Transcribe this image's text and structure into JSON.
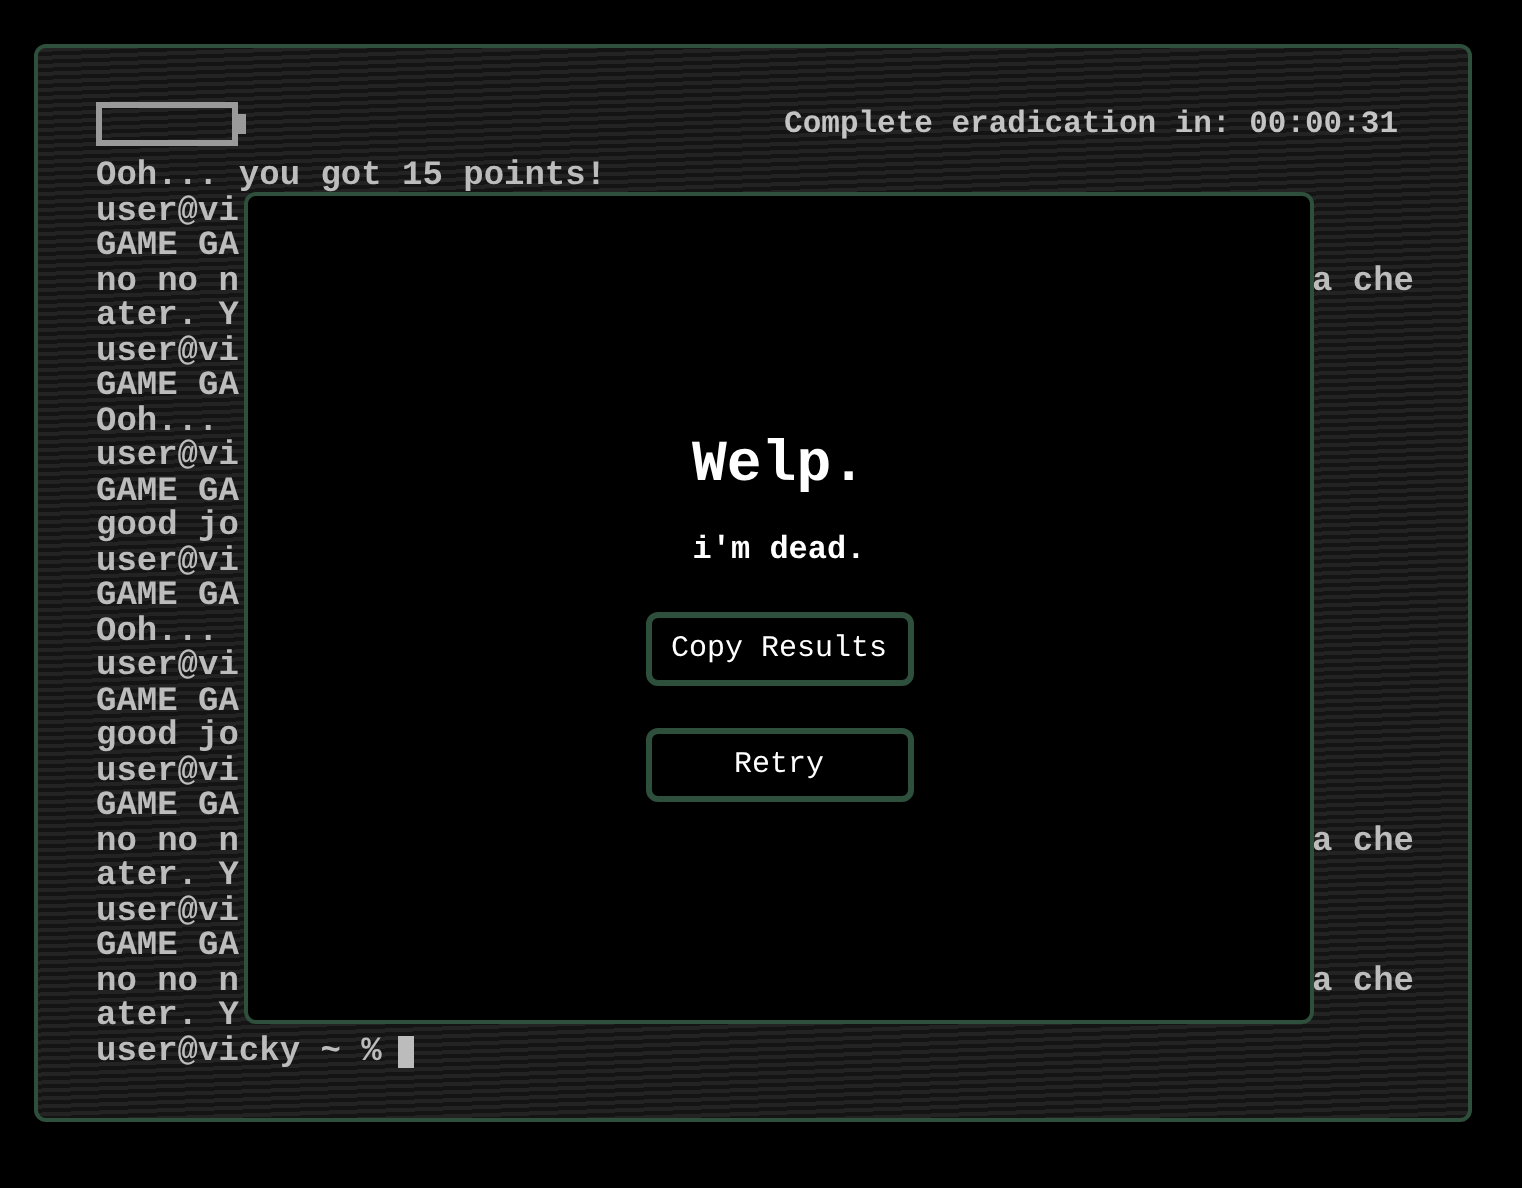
{
  "header": {
    "timer": "Complete eradication in: 00:00:31"
  },
  "terminal": {
    "lines": [
      {
        "text": "Ooh... you got 15 points!"
      },
      {
        "text": "user@vi"
      },
      {
        "text": "GAME GA"
      },
      {
        "text": "no no n",
        "right": "a che"
      },
      {
        "text": "ater. Y"
      },
      {
        "text": "user@vi"
      },
      {
        "text": "GAME GA"
      },
      {
        "text": "Ooh..."
      },
      {
        "text": "user@vi"
      },
      {
        "text": "GAME GA"
      },
      {
        "text": "good jo"
      },
      {
        "text": "user@vi"
      },
      {
        "text": "GAME GA"
      },
      {
        "text": "Ooh..."
      },
      {
        "text": "user@vi"
      },
      {
        "text": "GAME GA"
      },
      {
        "text": "good jo"
      },
      {
        "text": "user@vi"
      },
      {
        "text": "GAME GA"
      },
      {
        "text": "no no n",
        "right": "a che"
      },
      {
        "text": "ater. Y"
      },
      {
        "text": "user@vi"
      },
      {
        "text": "GAME GA"
      },
      {
        "text": "no no n",
        "right": "a che"
      },
      {
        "text": "ater. Y"
      }
    ],
    "prompt": "user@vicky ~ %"
  },
  "dialog": {
    "title": "Welp.",
    "message": "i'm dead.",
    "buttons": [
      {
        "label": "Copy Results"
      },
      {
        "label": "Retry"
      }
    ]
  }
}
